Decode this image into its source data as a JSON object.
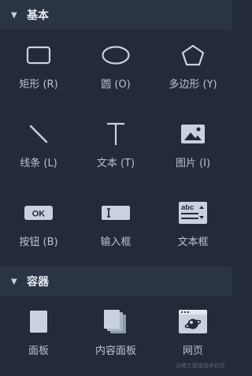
{
  "sections": {
    "basic": {
      "title": "基本",
      "items": [
        {
          "label": "矩形 (R)",
          "icon": "rectangle-icon"
        },
        {
          "label": "圆 (O)",
          "icon": "ellipse-icon"
        },
        {
          "label": "多边形 (Y)",
          "icon": "pentagon-icon"
        },
        {
          "label": "线条 (L)",
          "icon": "line-icon"
        },
        {
          "label": "文本 (T)",
          "icon": "text-icon"
        },
        {
          "label": "图片 (I)",
          "icon": "image-icon"
        },
        {
          "label": "按钮 (B)",
          "icon": "button-icon",
          "badge": "OK"
        },
        {
          "label": "输入框",
          "icon": "input-icon"
        },
        {
          "label": "文本框",
          "icon": "textarea-icon",
          "badge": "abc"
        }
      ]
    },
    "container": {
      "title": "容器",
      "items": [
        {
          "label": "面板",
          "icon": "panel-icon"
        },
        {
          "label": "内容面板",
          "icon": "content-panel-icon"
        },
        {
          "label": "网页",
          "icon": "webpage-icon"
        }
      ]
    }
  },
  "watermark": "@稀土掘金技术社区",
  "colors": {
    "background": "#232b39",
    "header": "#2b3445",
    "icon": "#c9d1de",
    "text": "#b9c2d0"
  }
}
